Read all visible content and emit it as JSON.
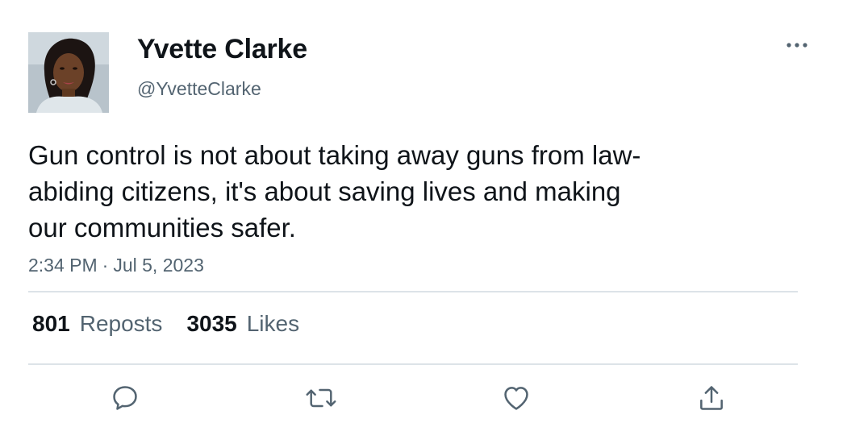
{
  "author": {
    "display_name": "Yvette Clarke",
    "handle": "@YvetteClarke",
    "avatar_icon": "profile-photo"
  },
  "tweet": {
    "text_lines": [
      "Gun control is not about taking away guns from law-",
      "abiding citizens, it's about saving lives and making",
      "our communities safer."
    ],
    "time": "2:34 PM",
    "separator": "·",
    "date": "Jul 5, 2023"
  },
  "stats": {
    "reposts_count": "801",
    "reposts_label": "Reposts",
    "likes_count": "3035",
    "likes_label": "Likes"
  },
  "actions": [
    {
      "name": "reply",
      "icon": "reply-icon"
    },
    {
      "name": "repost",
      "icon": "repost-icon"
    },
    {
      "name": "like",
      "icon": "heart-icon"
    },
    {
      "name": "share",
      "icon": "share-icon"
    }
  ],
  "colors": {
    "text_primary": "#0f1419",
    "text_secondary": "#536471",
    "divider": "#dde3e8"
  }
}
